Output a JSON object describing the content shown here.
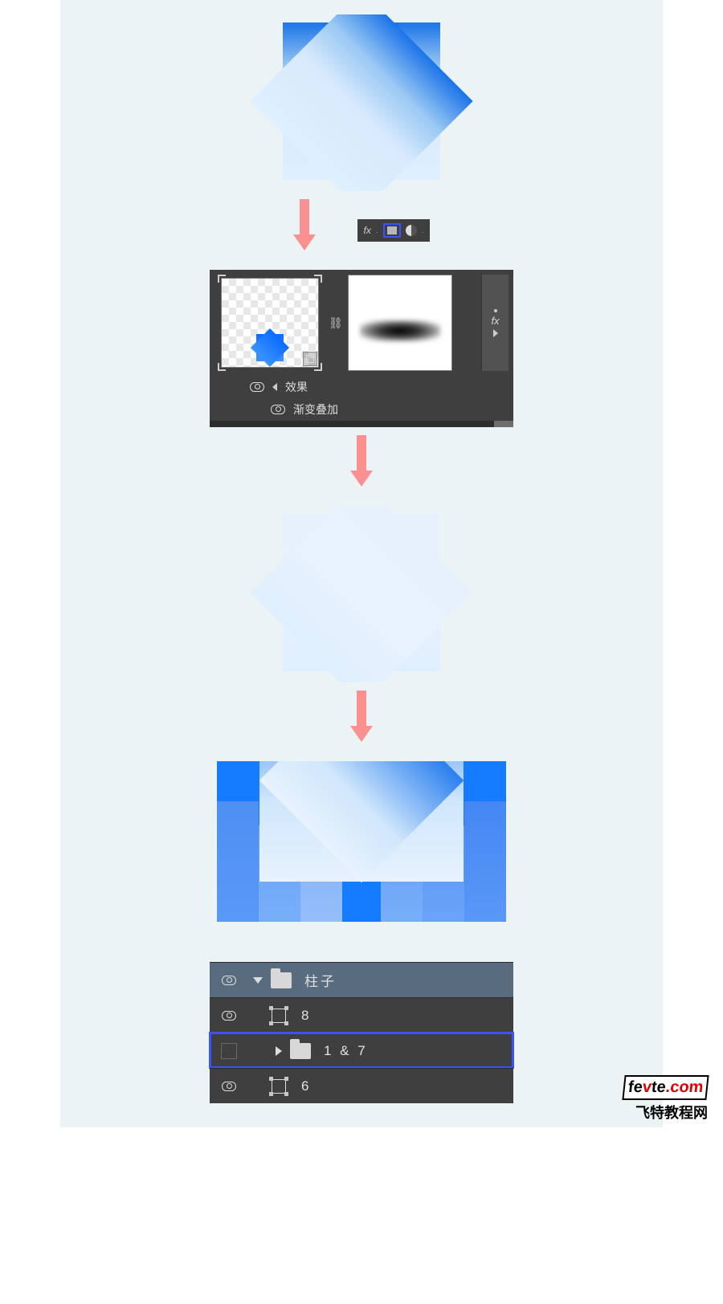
{
  "fxbar": {
    "fx": "fx",
    "dot": "."
  },
  "mask_panel": {
    "link": "⛓",
    "fx_side": "fx",
    "effects_label": "效果",
    "gradient_overlay_label": "渐变叠加"
  },
  "layers": {
    "group_name": "柱子",
    "layer8": "8",
    "layer17": "1 & 7",
    "layer6": "6"
  },
  "watermark": {
    "main_a": "fe",
    "main_b": "v",
    "main_c": "te",
    "main_d": ".com",
    "sub": "飞特教程网"
  }
}
